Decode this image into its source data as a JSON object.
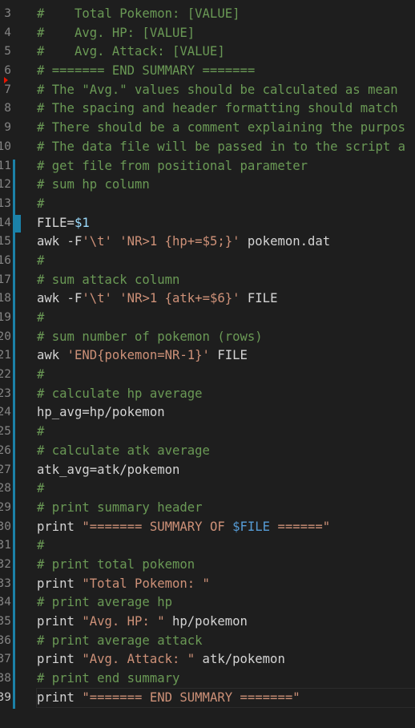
{
  "editor": {
    "line_numbers": [
      "3",
      "4",
      "5",
      "6",
      "7",
      "8",
      "9",
      "10",
      "11",
      "12",
      "13",
      "14",
      "15",
      "16",
      "17",
      "18",
      "19",
      "20",
      "21",
      "22",
      "23",
      "24",
      "25",
      "26",
      "27",
      "28",
      "29",
      "30",
      "31",
      "32",
      "33",
      "34",
      "35",
      "36",
      "37",
      "38",
      "39"
    ],
    "active_line": "39",
    "lines": [
      {
        "segments": [
          {
            "cls": "c",
            "text": "#    Total Pokemon: [VALUE]"
          }
        ]
      },
      {
        "segments": [
          {
            "cls": "c",
            "text": "#    Avg. HP: [VALUE]"
          }
        ]
      },
      {
        "segments": [
          {
            "cls": "c",
            "text": "#    Avg. Attack: [VALUE]"
          }
        ]
      },
      {
        "segments": [
          {
            "cls": "c",
            "text": "# ======= END SUMMARY ======="
          }
        ]
      },
      {
        "segments": [
          {
            "cls": "c",
            "text": "# The \"Avg.\" values should be calculated as mean"
          }
        ]
      },
      {
        "segments": [
          {
            "cls": "c",
            "text": "# The spacing and header formatting should match"
          }
        ]
      },
      {
        "segments": [
          {
            "cls": "c",
            "text": "# There should be a comment explaining the purpos"
          }
        ]
      },
      {
        "segments": [
          {
            "cls": "c",
            "text": "# The data file will be passed in to the script a"
          }
        ]
      },
      {
        "segments": [
          {
            "cls": "c",
            "text": "# get file from positional parameter"
          }
        ]
      },
      {
        "segments": [
          {
            "cls": "c",
            "text": "# sum hp column"
          }
        ]
      },
      {
        "segments": [
          {
            "cls": "c",
            "text": "#"
          }
        ]
      },
      {
        "segments": [
          {
            "cls": "p",
            "text": "FILE="
          },
          {
            "cls": "v",
            "text": "$1"
          }
        ]
      },
      {
        "segments": [
          {
            "cls": "p",
            "text": "awk -F"
          },
          {
            "cls": "s",
            "text": "'\\t'"
          },
          {
            "cls": "p",
            "text": " "
          },
          {
            "cls": "s",
            "text": "'NR>1 {hp+=$5;}'"
          },
          {
            "cls": "p",
            "text": " pokemon.dat"
          }
        ]
      },
      {
        "segments": [
          {
            "cls": "c",
            "text": "#"
          }
        ]
      },
      {
        "segments": [
          {
            "cls": "c",
            "text": "# sum attack column"
          }
        ]
      },
      {
        "segments": [
          {
            "cls": "p",
            "text": "awk -F"
          },
          {
            "cls": "s",
            "text": "'\\t'"
          },
          {
            "cls": "p",
            "text": " "
          },
          {
            "cls": "s",
            "text": "'NR>1 {atk+=$6}'"
          },
          {
            "cls": "p",
            "text": " FILE"
          }
        ]
      },
      {
        "segments": [
          {
            "cls": "c",
            "text": "#"
          }
        ]
      },
      {
        "segments": [
          {
            "cls": "c",
            "text": "# sum number of pokemon (rows)"
          }
        ]
      },
      {
        "segments": [
          {
            "cls": "p",
            "text": "awk "
          },
          {
            "cls": "s",
            "text": "'END{pokemon=NR-1}'"
          },
          {
            "cls": "p",
            "text": " FILE"
          }
        ]
      },
      {
        "segments": [
          {
            "cls": "c",
            "text": "#"
          }
        ]
      },
      {
        "segments": [
          {
            "cls": "c",
            "text": "# calculate hp average"
          }
        ]
      },
      {
        "segments": [
          {
            "cls": "p",
            "text": "hp_avg=hp/pokemon"
          }
        ]
      },
      {
        "segments": [
          {
            "cls": "c",
            "text": "#"
          }
        ]
      },
      {
        "segments": [
          {
            "cls": "c",
            "text": "# calculate atk average"
          }
        ]
      },
      {
        "segments": [
          {
            "cls": "p",
            "text": "atk_avg=atk/pokemon"
          }
        ]
      },
      {
        "segments": [
          {
            "cls": "c",
            "text": "#"
          }
        ]
      },
      {
        "segments": [
          {
            "cls": "c",
            "text": "# print summary header"
          }
        ]
      },
      {
        "segments": [
          {
            "cls": "p",
            "text": "print "
          },
          {
            "cls": "s",
            "text": "\"======= SUMMARY OF "
          },
          {
            "cls": "vb",
            "text": "$FILE"
          },
          {
            "cls": "s",
            "text": " ======\""
          }
        ]
      },
      {
        "segments": [
          {
            "cls": "c",
            "text": "#"
          }
        ]
      },
      {
        "segments": [
          {
            "cls": "c",
            "text": "# print total pokemon"
          }
        ]
      },
      {
        "segments": [
          {
            "cls": "p",
            "text": "print "
          },
          {
            "cls": "s",
            "text": "\"Total Pokemon: \""
          }
        ]
      },
      {
        "segments": [
          {
            "cls": "c",
            "text": "# print average hp"
          }
        ]
      },
      {
        "segments": [
          {
            "cls": "p",
            "text": "print "
          },
          {
            "cls": "s",
            "text": "\"Avg. HP: \""
          },
          {
            "cls": "p",
            "text": " hp/pokemon"
          }
        ]
      },
      {
        "segments": [
          {
            "cls": "c",
            "text": "# print average attack"
          }
        ]
      },
      {
        "segments": [
          {
            "cls": "p",
            "text": "print "
          },
          {
            "cls": "s",
            "text": "\"Avg. Attack: \""
          },
          {
            "cls": "p",
            "text": " atk/pokemon"
          }
        ]
      },
      {
        "segments": [
          {
            "cls": "c",
            "text": "# print end summary"
          }
        ]
      },
      {
        "segments": [
          {
            "cls": "p",
            "text": "print "
          },
          {
            "cls": "s",
            "text": "\"======= END SUMMARY =======\""
          }
        ]
      }
    ]
  },
  "colors": {
    "background": "#1e1e1e",
    "comment": "#6a9955",
    "string": "#ce9178",
    "variable": "#9cdcfe",
    "gutter_change": "#1b81a8"
  }
}
